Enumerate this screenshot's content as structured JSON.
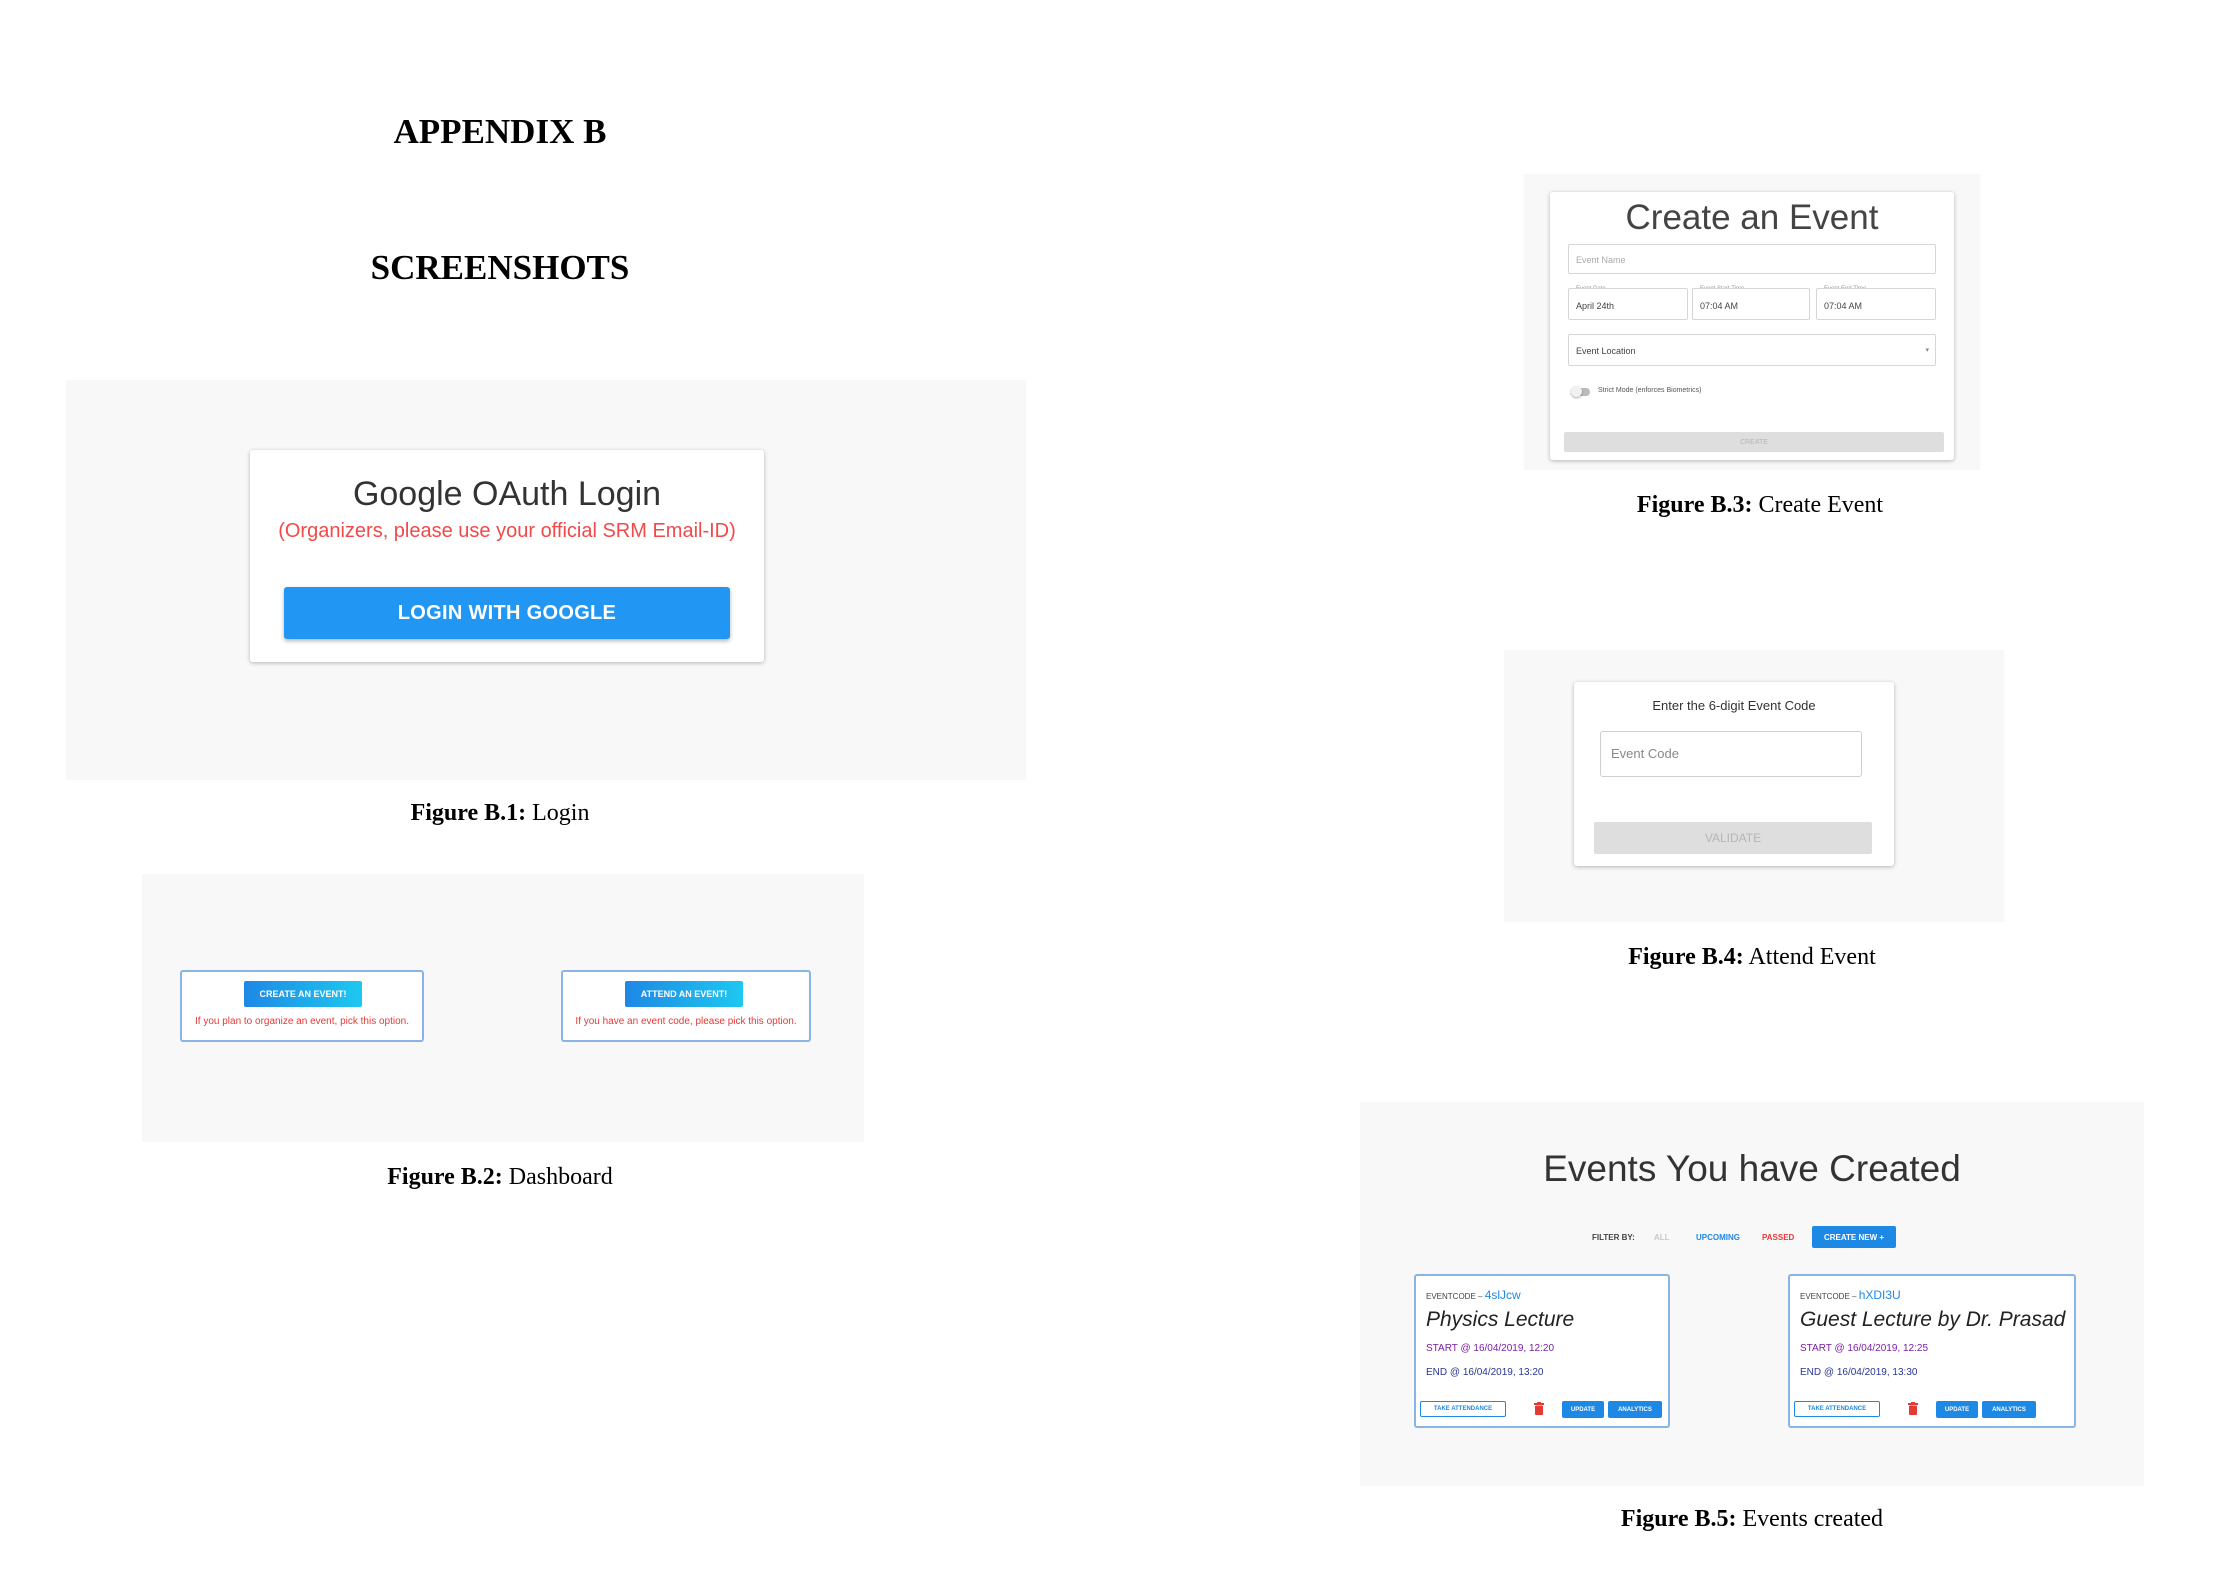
{
  "page": {
    "heading": "APPENDIX B",
    "subheading": "SCREENSHOTS"
  },
  "figure1": {
    "label": "Figure B.1:",
    "caption": "Login",
    "title": "Google OAuth Login",
    "subtitle": "(Organizers, please use your official SRM Email-ID)",
    "button": "LOGIN WITH GOOGLE"
  },
  "figure2": {
    "label": "Figure B.2:",
    "caption": "Dashboard",
    "create_button": "CREATE AN EVENT!",
    "create_hint": "If you plan to organize an event, pick this option.",
    "attend_button": "ATTEND AN EVENT!",
    "attend_hint": "If you have an event code, please pick this option."
  },
  "figure3": {
    "label": "Figure B.3:",
    "caption": "Create Event",
    "title": "Create an Event",
    "event_name_placeholder": "Event Name",
    "date_label": "Event Date",
    "date_value": "April 24th",
    "start_label": "Event Start Time",
    "start_value": "07:04 AM",
    "end_label": "Event End Time",
    "end_value": "07:04 AM",
    "location_placeholder": "Event Location",
    "strict_mode": "Strict Mode (enforces Biometrics)",
    "create_button": "CREATE"
  },
  "figure4": {
    "label": "Figure B.4:",
    "caption": "Attend Event",
    "title": "Enter the 6-digit Event Code",
    "input_placeholder": "Event Code",
    "validate_button": "VALIDATE"
  },
  "figure5": {
    "label": "Figure B.5:",
    "caption": "Events created",
    "title": "Events You have Created",
    "filter_label": "FILTER BY:",
    "filters": [
      "ALL",
      "UPCOMING",
      "PASSED"
    ],
    "create_new": "CREATE NEW +",
    "events": [
      {
        "code_prefix": "EVENTCODE – ",
        "code": "4slJcw",
        "name": "Physics Lecture",
        "start": "START @ 16/04/2019, 12:20",
        "end": "END @ 16/04/2019, 13:20"
      },
      {
        "code_prefix": "EVENTCODE – ",
        "code": "hXDI3U",
        "name": "Guest Lecture by Dr. Prasad",
        "start": "START @ 16/04/2019, 12:25",
        "end": "END @ 16/04/2019, 13:30"
      }
    ],
    "take_attendance": "TAKE ATTENDANCE",
    "update": "UPDATE",
    "analytics": "ANALYTICS"
  },
  "colors": {
    "primary_blue": "#2196f3",
    "error_red": "#f04a4a",
    "panel_bg": "#f8f8f8",
    "card_border": "#8ab4e6"
  }
}
